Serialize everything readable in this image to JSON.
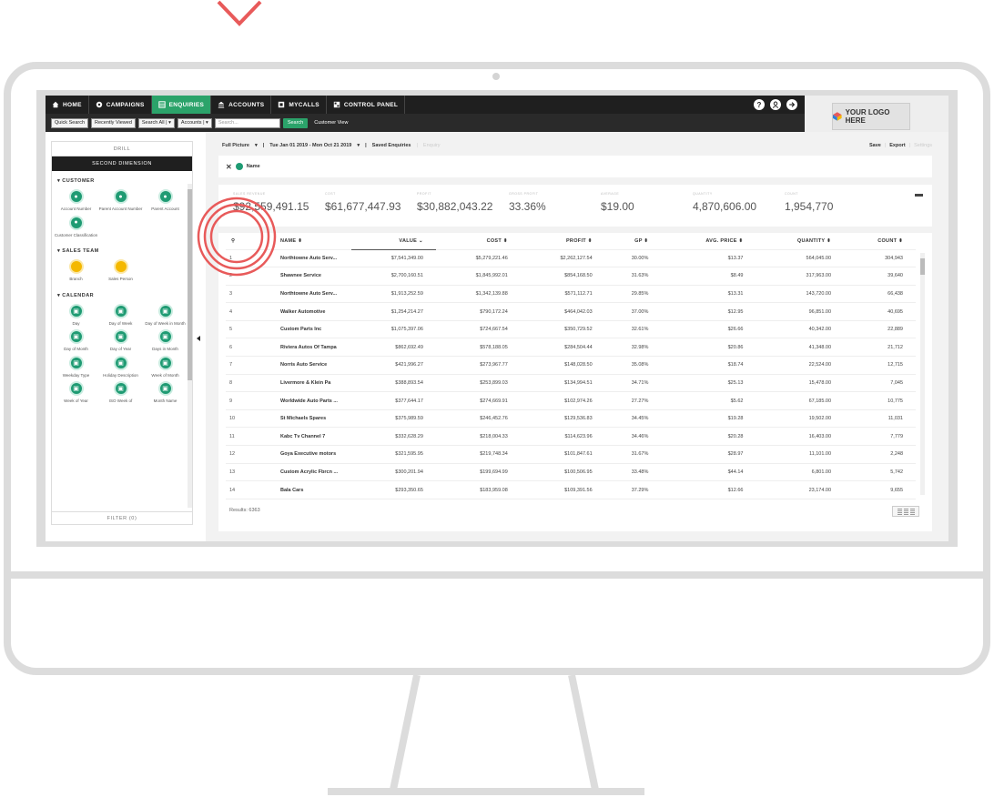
{
  "nav": {
    "items": [
      {
        "label": "HOME",
        "icon": "home-icon",
        "active": false
      },
      {
        "label": "CAMPAIGNS",
        "icon": "campaign-icon",
        "active": false
      },
      {
        "label": "ENQUIRIES",
        "icon": "grid-icon",
        "active": true
      },
      {
        "label": "ACCOUNTS",
        "icon": "bank-icon",
        "active": false
      },
      {
        "label": "MYCALLS",
        "icon": "calls-icon",
        "active": false
      },
      {
        "label": "CONTROL PANEL",
        "icon": "panel-icon",
        "active": false
      }
    ],
    "help": "?",
    "logo_text": "YOUR LOGO HERE"
  },
  "subbar": {
    "quick_search": "Quick Search",
    "recently_viewed": "Recently Viewed",
    "search_all": "Search All",
    "accounts": "Accounts",
    "search_placeholder": "Search...",
    "search_button": "Search",
    "customer_view": "Customer View"
  },
  "sidebar": {
    "drill": "DRILL",
    "second_dimension": "SECOND DIMENSION",
    "sections": [
      {
        "title": "CUSTOMER",
        "color": "green",
        "items": [
          "Account Number",
          "Parent Account Number",
          "Parent Account",
          "Customer Classification"
        ]
      },
      {
        "title": "SALES TEAM",
        "color": "yellow",
        "items": [
          "Branch",
          "Sales Person"
        ]
      },
      {
        "title": "CALENDAR",
        "color": "green",
        "items": [
          "Day",
          "Day of Week",
          "Day of Week in Month",
          "Day of Month",
          "Day of Year",
          "Days in Month",
          "Weekday Type",
          "Holiday Description",
          "Week of Month",
          "Week of Year",
          "ISO Week of",
          "Month Name"
        ]
      }
    ],
    "filter": "FILTER (0)"
  },
  "crumbs": {
    "full_picture": "Full Picture",
    "date_range": "Tue Jan 01 2019 - Mon Oct 21 2019",
    "saved": "Saved Enquiries",
    "enquiry": "Enquiry"
  },
  "actions": {
    "save": "Save",
    "export": "Export",
    "settings": "Settings"
  },
  "filter_chip": "Name",
  "kpis": [
    {
      "label": "SALES REVENUE",
      "value": "$92,559,491.15"
    },
    {
      "label": "COST",
      "value": "$61,677,447.93"
    },
    {
      "label": "PROFIT",
      "value": "$30,882,043.22"
    },
    {
      "label": "GROSS PROFIT",
      "value": "33.36%"
    },
    {
      "label": "AVERAGE",
      "value": "$19.00"
    },
    {
      "label": "QUANTITY",
      "value": "4,870,606.00"
    },
    {
      "label": "COUNT",
      "value": "1,954,770"
    }
  ],
  "table": {
    "columns": [
      "NAME ⬍",
      "VALUE ⌄",
      "COST ⬍",
      "PROFIT ⬍",
      "GP ⬍",
      "AVG. PRICE ⬍",
      "QUANTITY ⬍",
      "COUNT ⬍"
    ],
    "rows": [
      [
        "1",
        "Northtowne Auto Serv...",
        "$7,541,349.00",
        "$5,279,221.46",
        "$2,262,127.54",
        "30.00%",
        "$13.37",
        "564,045.00",
        "304,943"
      ],
      [
        "2",
        "Shawnee Service",
        "$2,700,160.51",
        "$1,845,992.01",
        "$854,168.50",
        "31.63%",
        "$8.49",
        "317,963.00",
        "39,640"
      ],
      [
        "3",
        "Northtowne Auto Serv...",
        "$1,913,252.59",
        "$1,342,139.88",
        "$571,112.71",
        "29.85%",
        "$13.31",
        "143,720.00",
        "66,438"
      ],
      [
        "4",
        "Walker Automotive",
        "$1,254,214.27",
        "$790,172.24",
        "$464,042.03",
        "37.00%",
        "$12.95",
        "96,851.00",
        "40,695"
      ],
      [
        "5",
        "Custom Parts Inc",
        "$1,075,397.06",
        "$724,667.54",
        "$350,729.52",
        "32.61%",
        "$26.66",
        "40,342.00",
        "22,889"
      ],
      [
        "6",
        "Riviera Autos Of Tampa",
        "$862,692.49",
        "$578,188.05",
        "$284,504.44",
        "32.98%",
        "$20.86",
        "41,348.00",
        "21,712"
      ],
      [
        "7",
        "Norris Auto Service",
        "$421,996.27",
        "$273,967.77",
        "$148,028.50",
        "35.08%",
        "$18.74",
        "22,524.00",
        "12,715"
      ],
      [
        "8",
        "Livermore & Klein Pa",
        "$388,893.54",
        "$253,899.03",
        "$134,994.51",
        "34.71%",
        "$25.13",
        "15,478.00",
        "7,045"
      ],
      [
        "9",
        "Worldwide Auto Parts ...",
        "$377,644.17",
        "$274,669.91",
        "$102,974.26",
        "27.27%",
        "$5.62",
        "67,185.00",
        "10,775"
      ],
      [
        "10",
        "St Michaels Spares",
        "$375,989.59",
        "$246,452.76",
        "$129,536.83",
        "34.45%",
        "$19.28",
        "19,502.00",
        "11,031"
      ],
      [
        "11",
        "Kabc Tv Channel 7",
        "$332,628.29",
        "$218,004.33",
        "$114,623.96",
        "34.46%",
        "$20.28",
        "16,403.00",
        "7,779"
      ],
      [
        "12",
        "Goya Executive motors",
        "$321,595.95",
        "$219,748.34",
        "$101,847.61",
        "31.67%",
        "$28.97",
        "11,101.00",
        "2,248"
      ],
      [
        "13",
        "Custom Acrylic Fbrcn ...",
        "$300,201.94",
        "$199,694.99",
        "$100,506.95",
        "33.48%",
        "$44.14",
        "6,801.00",
        "5,742"
      ],
      [
        "14",
        "Bala Cars",
        "$293,350.65",
        "$183,959.08",
        "$109,391.56",
        "37.29%",
        "$12.66",
        "23,174.00",
        "9,655"
      ]
    ],
    "results": "Results: 6363"
  },
  "colors": {
    "accent": "#2ba36a",
    "highlight": "#e85a5a",
    "nav_bg": "#1f1f1f"
  }
}
